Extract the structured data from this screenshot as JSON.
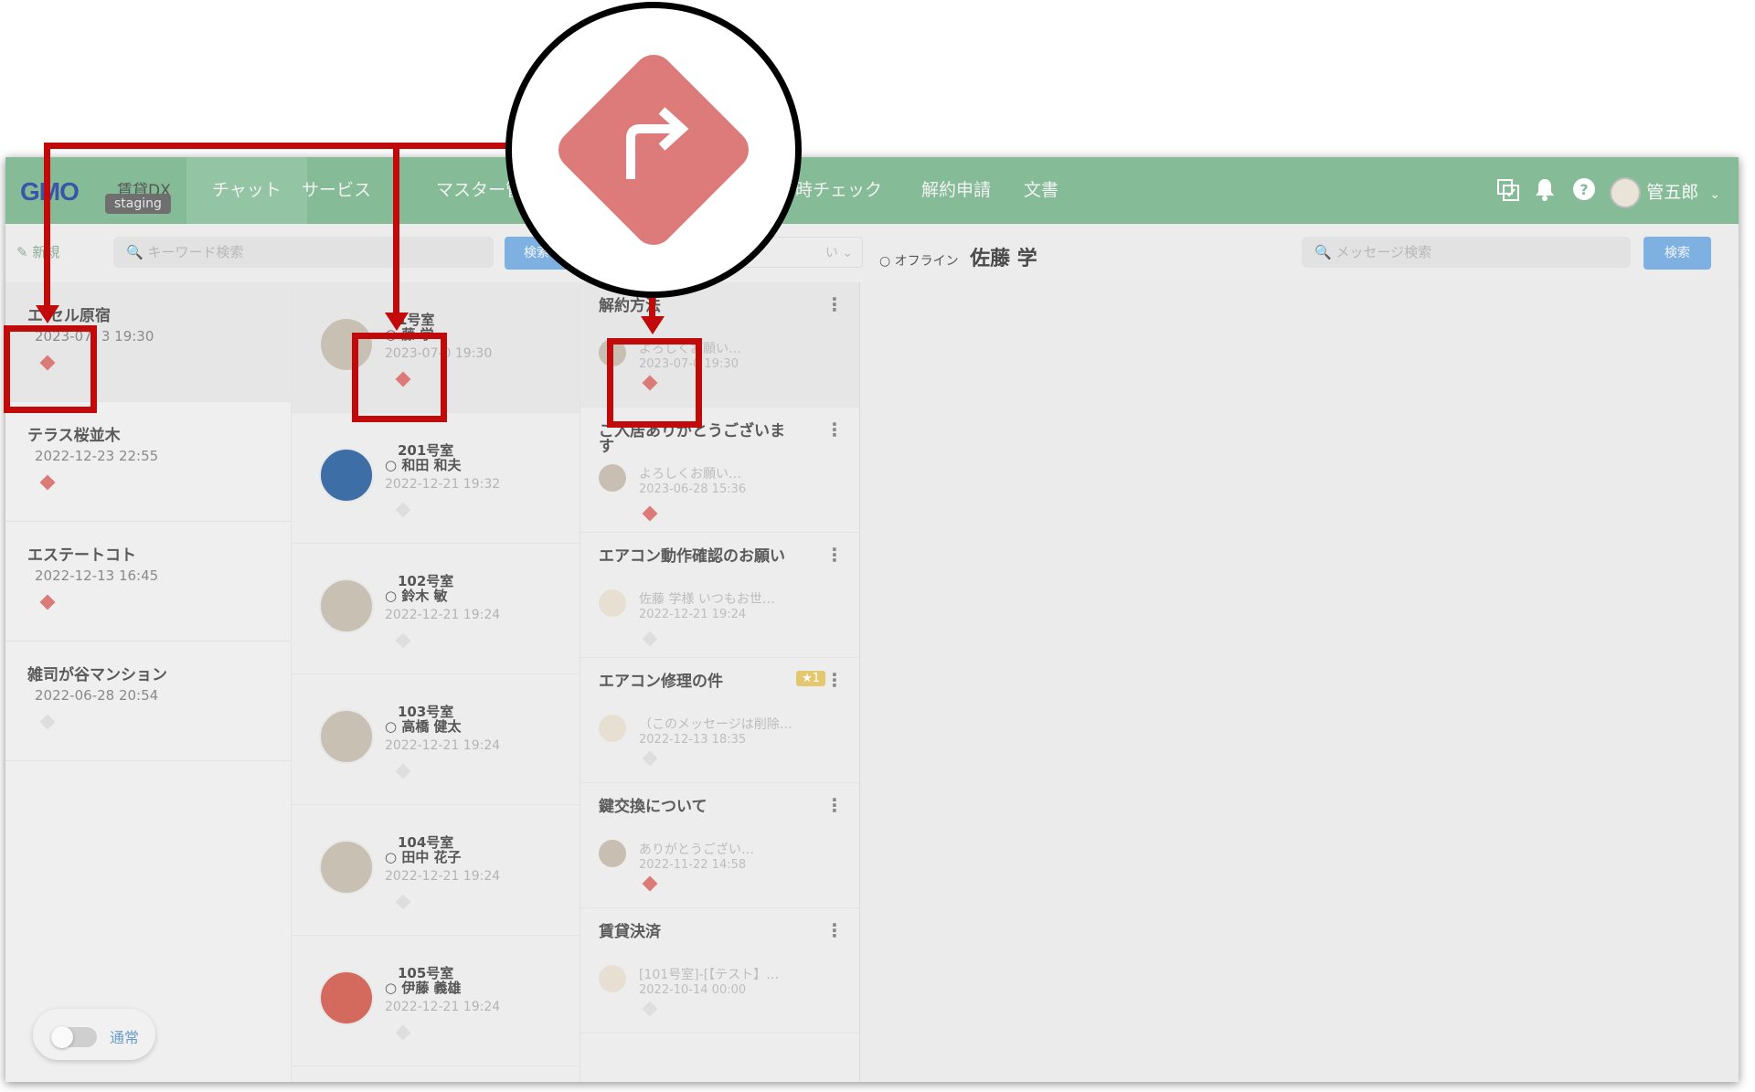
{
  "app": {
    "logo": "GMO",
    "logo_sub": "賃貸DX",
    "env_badge": "staging"
  },
  "nav": {
    "items": [
      {
        "label": "チャット",
        "active": true
      },
      {
        "label": "サービス",
        "active": false
      },
      {
        "label": "マスター管",
        "active": false
      },
      {
        "label": "時チェック",
        "active": false
      },
      {
        "label": "解約申請",
        "active": false
      },
      {
        "label": "文書",
        "active": false
      }
    ]
  },
  "header": {
    "user_name": "管五郎",
    "icons": [
      "copy-check-icon",
      "bell-icon",
      "help-icon"
    ]
  },
  "toolbar": {
    "new_label": "新規",
    "search_placeholder": "キーワード検索",
    "search_button": "検索",
    "filter_value": "い",
    "status": "オフライン",
    "chat_user": "佐藤 学",
    "message_search_placeholder": "メッセージ検索",
    "message_search_button": "検索"
  },
  "properties": [
    {
      "name": "エ セル原宿",
      "date": "2023-07- 3 19:30",
      "flag": "red",
      "selected": true
    },
    {
      "name": "テラス桜並木",
      "date": "2022-12-23 22:55",
      "flag": "red",
      "selected": false
    },
    {
      "name": "エステートコト",
      "date": "2022-12-13 16:45",
      "flag": "red",
      "selected": false
    },
    {
      "name": "雑司が谷マンション",
      "date": "2022-06-28 20:54",
      "flag": "grey",
      "selected": false
    }
  ],
  "rooms": [
    {
      "room": "1号室",
      "tenant": "藤 学",
      "date": "2023-07-0 19:30",
      "flag": "red",
      "selected": true
    },
    {
      "room": "201号室",
      "tenant": "和田 和夫",
      "date": "2022-12-21 19:32",
      "flag": "grey",
      "selected": false
    },
    {
      "room": "102号室",
      "tenant": "鈴木 敏",
      "date": "2022-12-21 19:24",
      "flag": "grey",
      "selected": false
    },
    {
      "room": "103号室",
      "tenant": "高橋 健太",
      "date": "2022-12-21 19:24",
      "flag": "grey",
      "selected": false
    },
    {
      "room": "104号室",
      "tenant": "田中 花子",
      "date": "2022-12-21 19:24",
      "flag": "grey",
      "selected": false
    },
    {
      "room": "105号室",
      "tenant": "伊藤 義雄",
      "date": "2022-12-21 19:24",
      "flag": "grey",
      "selected": false
    }
  ],
  "threads": [
    {
      "title": "解約方法",
      "preview": "よろしくお願い…",
      "date": "2023-07-0 19:30",
      "flag": "red",
      "badge": "",
      "selected": true
    },
    {
      "title": "ご入居ありがとうございます",
      "preview": "よろしくお願い…",
      "date": "2023-06-28 15:36",
      "flag": "red",
      "badge": "",
      "selected": false
    },
    {
      "title": "エアコン動作確認のお願い",
      "preview": "佐藤 学様 いつもお世…",
      "date": "2022-12-21 19:24",
      "flag": "grey",
      "badge": "",
      "selected": false
    },
    {
      "title": "エアコン修理の件",
      "preview": "（このメッセージは削除…",
      "date": "2022-12-13 18:35",
      "flag": "grey",
      "badge": "★1",
      "selected": false
    },
    {
      "title": "鍵交換について",
      "preview": "ありがとうござい…",
      "date": "2022-11-22 14:58",
      "flag": "red",
      "badge": "",
      "selected": false
    },
    {
      "title": "賃貸決済",
      "preview": "[101号室]-[【テスト】…",
      "date": "2022-10-14 00:00",
      "flag": "grey",
      "badge": "",
      "selected": false
    }
  ],
  "mode_toggle": {
    "label": "通常",
    "on": false
  },
  "zoom_icon": "turn-right-arrow-diamond-icon",
  "colors": {
    "header": "#86bb98",
    "flag_red": "#dc7a78",
    "highlight": "#c20a0a",
    "button_blue": "#7eb0e2"
  }
}
